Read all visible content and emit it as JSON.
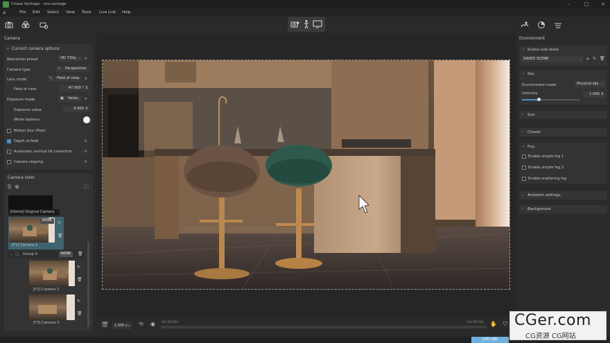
{
  "app": {
    "title": "Chaos Vantage - ssv.vantage"
  },
  "menu": [
    "File",
    "Edit",
    "Select",
    "View",
    "Tools",
    "Live Link",
    "Help"
  ],
  "left": {
    "camera_title": "Camera",
    "current_options_title": "Current camera options",
    "resolution_preset_label": "Resolution preset",
    "resolution_preset_value": "HD 720p",
    "camera_type_label": "Camera type",
    "camera_type_value": "Perspective",
    "lens_mode_label": "Lens mode",
    "lens_mode_value": "Field of view",
    "fov_label": "Field of view",
    "fov_value": "47.000 °",
    "exposure_mode_label": "Exposure mode",
    "exposure_mode_value": "Value",
    "exposure_value_label": "Exposure value",
    "exposure_value": "9.000",
    "white_balance_label": "White balance",
    "motion_blur_label": "Motion blur (Post)",
    "depth_of_field_label": "Depth of field",
    "auto_tilt_label": "Automatic vertical tilt correction",
    "camera_clipping_label": "Camera clipping",
    "camera_lister_title": "Camera lister",
    "home_camera_label": "[Home] Original Camera",
    "cam1_label": "[F1] Camera 1",
    "cam1_badge": "NONE",
    "group_label": "Group 0",
    "group_badge": "NONE",
    "cam2_label": "[F2] Camera 2",
    "cam3_label": "[F3] Camera 3"
  },
  "bottom": {
    "zoom": "1.000 x",
    "time_start": "0m:00.00s",
    "time_end": "0m:00.00s"
  },
  "right": {
    "environment_title": "Environment",
    "scene_substate_title": "Scene sub-state",
    "saved_scene_value": "SAVED SCENE",
    "sky_title": "Sky",
    "env_mode_label": "Environment mode",
    "env_mode_value": "Physical sky",
    "intensity_label": "Intensity",
    "intensity_value": "1.000",
    "sun_title": "Sun",
    "clouds_title": "Clouds",
    "fog_title": "Fog",
    "fog1_label": "Enable simple fog 1",
    "fog2_label": "Enable simple fog 2",
    "fog3_label": "Enable scattering fog",
    "ambient_title": "Ambient settings",
    "background_title": "Background"
  },
  "status": {
    "live_link": "LIVE LINK"
  },
  "watermark": {
    "big": "CGer.com",
    "small": "CG资源  CG网站"
  },
  "state": {
    "depth_of_field": true,
    "motion_blur": false,
    "auto_tilt": false,
    "camera_clipping": false,
    "intensity_fraction": 0.28
  }
}
